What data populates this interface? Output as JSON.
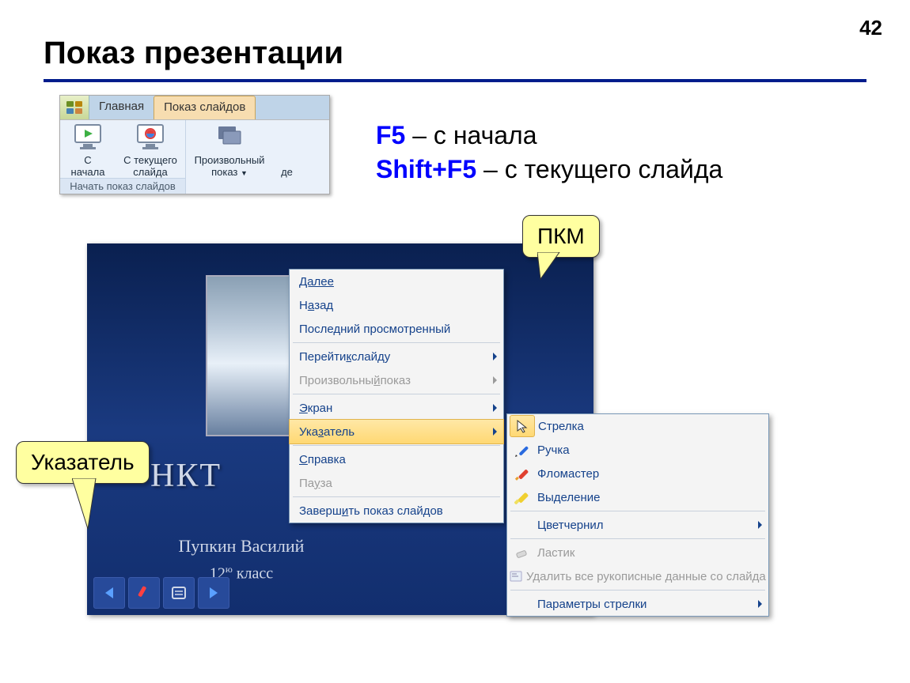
{
  "pageNumber": "42",
  "title": "Показ презентации",
  "ribbon": {
    "tabHome": "Главная",
    "tabSlideshow": "Показ слайдов",
    "btnFromStart1": "С",
    "btnFromStart2": "начала",
    "btnFromCurrent1": "С текущего",
    "btnFromCurrent2": "слайда",
    "btnCustom1": "Произвольный",
    "btnCustom2": "показ",
    "partialD": "де",
    "groupLabel": "Начать показ слайдов"
  },
  "shortcuts": {
    "k1": "F5",
    "t1": " – с начала",
    "k2": "Shift+F5",
    "t2": " – с текущего слайда"
  },
  "callouts": {
    "pkm": "ПКМ",
    "pointer": "Указатель"
  },
  "presentation": {
    "titleFragment": "НКТ",
    "author": "Пупкин Василий",
    "gradePrefix": "12",
    "gradeSup": "ю",
    "gradeSuffix": " класс"
  },
  "menu": {
    "next": "Далее",
    "back_pre": "Н",
    "back_u": "а",
    "back_post": "зад",
    "lastViewed": "Последний просмотренный",
    "goto_pre": "Перейти ",
    "goto_u": "к",
    "goto_post": " слайду",
    "custom_pre": "Произвольны",
    "custom_u": "й",
    "custom_post": " показ",
    "screen_u": "Э",
    "screen_post": "кран",
    "pointer_pre": "Ука",
    "pointer_u": "з",
    "pointer_post": "атель",
    "help_u": "С",
    "help_post": "правка",
    "pause_pre": "Па",
    "pause_u": "у",
    "pause_post": "за",
    "end_pre": "Заверш",
    "end_u": "и",
    "end_post": "ть показ слайдов"
  },
  "submenu": {
    "arrow_u": "С",
    "arrow_post": "трелка",
    "pen_pre": "Р",
    "pen_u": "у",
    "pen_post": "чка",
    "marker_u": "Ф",
    "marker_post": "ломастер",
    "highlight_u": "В",
    "highlight_post": "ыделение",
    "inkcolor_pre": "Цвет ",
    "inkcolor_u": "ч",
    "inkcolor_post": "ернил",
    "eraser_u": "Л",
    "eraser_post": "астик",
    "eraseall": "Удалить все рукописные данные со слайда",
    "arrowopts_pre": "Пара",
    "arrowopts_u": "м",
    "arrowopts_post": "етры стрелки"
  }
}
